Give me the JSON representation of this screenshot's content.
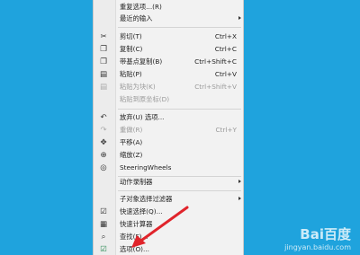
{
  "menu": {
    "repeat_options": "重复选项...(R)",
    "recent_input": "最近的输入",
    "cut": "剪切(T)",
    "cut_sc": "Ctrl+X",
    "copy": "复制(C)",
    "copy_sc": "Ctrl+C",
    "copy_base": "带基点复制(B)",
    "copy_base_sc": "Ctrl+Shift+C",
    "paste": "粘贴(P)",
    "paste_sc": "Ctrl+V",
    "paste_block": "粘贴为块(K)",
    "paste_block_sc": "Ctrl+Shift+V",
    "paste_orig": "粘贴到原坐标(D)",
    "undo": "放弃(U) 选项...",
    "redo": "重做(R)",
    "redo_sc": "Ctrl+Y",
    "pan": "平移(A)",
    "zoom": "缩放(Z)",
    "steering": "SteeringWheels",
    "action_recorder": "动作录制器",
    "sub_filter": "子对象选择过滤器",
    "quick_select": "快速选择(Q)...",
    "quickcalc": "快速计算器",
    "find": "查找(F)...",
    "options": "选项(O)..."
  },
  "watermark": {
    "brand": "Bai百度",
    "sub": "jingyan.baidu.com"
  }
}
